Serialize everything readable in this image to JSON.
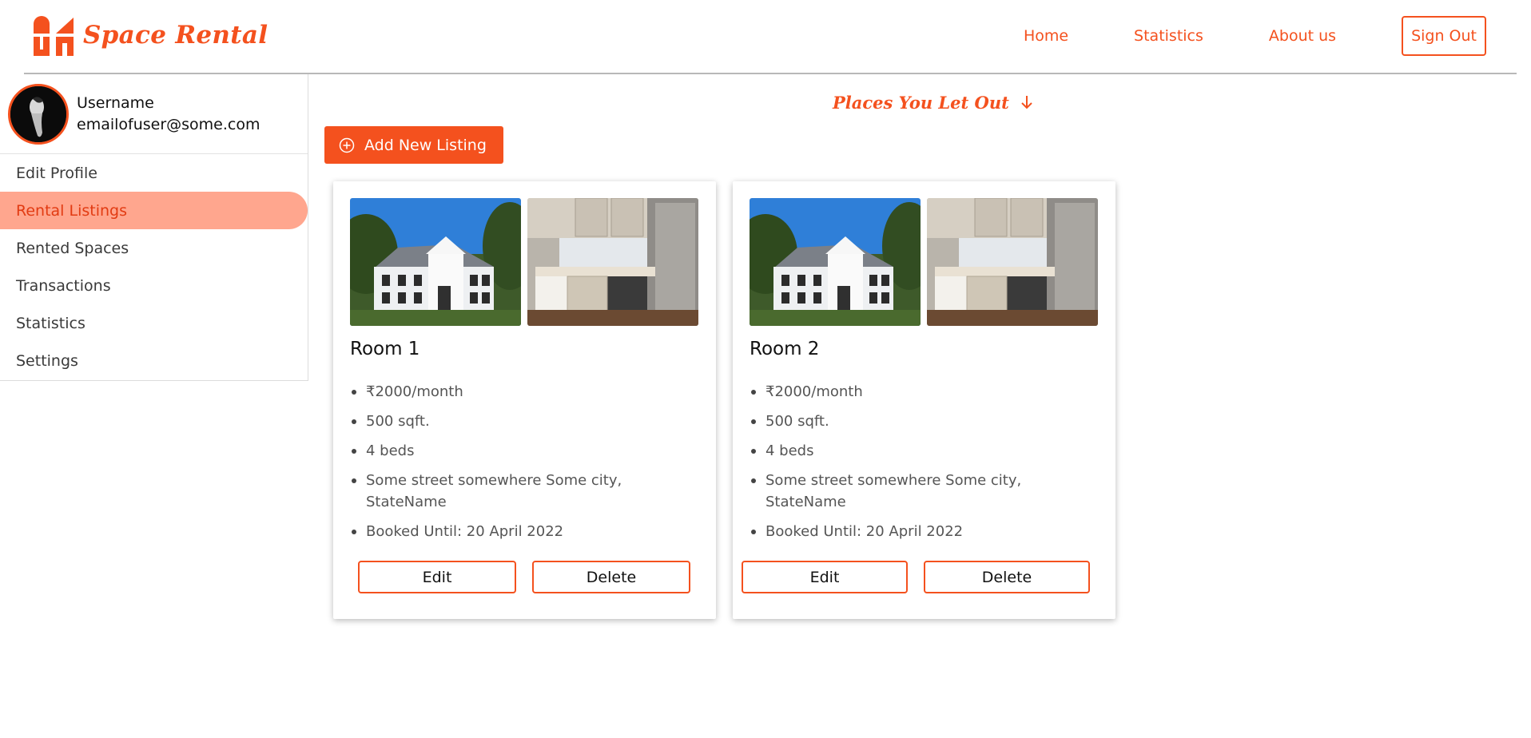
{
  "brand": {
    "name": "Space Rental",
    "color": "#f4511e"
  },
  "nav": {
    "links": [
      "Home",
      "Statistics",
      "About us"
    ],
    "signout_label": "Sign Out"
  },
  "user": {
    "username": "Username",
    "email": "emailofuser@some.com"
  },
  "sidebar": {
    "items": [
      {
        "label": "Edit Profile",
        "active": false
      },
      {
        "label": "Rental Listings",
        "active": true
      },
      {
        "label": "Rented Spaces",
        "active": false
      },
      {
        "label": "Transactions",
        "active": false
      },
      {
        "label": "Statistics",
        "active": false
      },
      {
        "label": "Settings",
        "active": false
      }
    ]
  },
  "main": {
    "title": "Places You Let Out",
    "title_icon": "arrow-down-icon",
    "add_button_label": "Add New Listing",
    "add_button_icon": "plus-circle-icon"
  },
  "listings": [
    {
      "title": "Room 1",
      "price": "₹2000/month",
      "area": "500 sqft.",
      "beds": "4 beds",
      "address": "Some street somewhere Some city, StateName",
      "booked": "Booked Until: 20 April 2022",
      "edit_label": "Edit",
      "delete_label": "Delete"
    },
    {
      "title": "Room 2",
      "price": "₹2000/month",
      "area": "500 sqft.",
      "beds": "4 beds",
      "address": "Some street somewhere Some city, StateName",
      "booked": "Booked Until: 20 April 2022",
      "edit_label": "Edit",
      "delete_label": "Delete"
    }
  ]
}
